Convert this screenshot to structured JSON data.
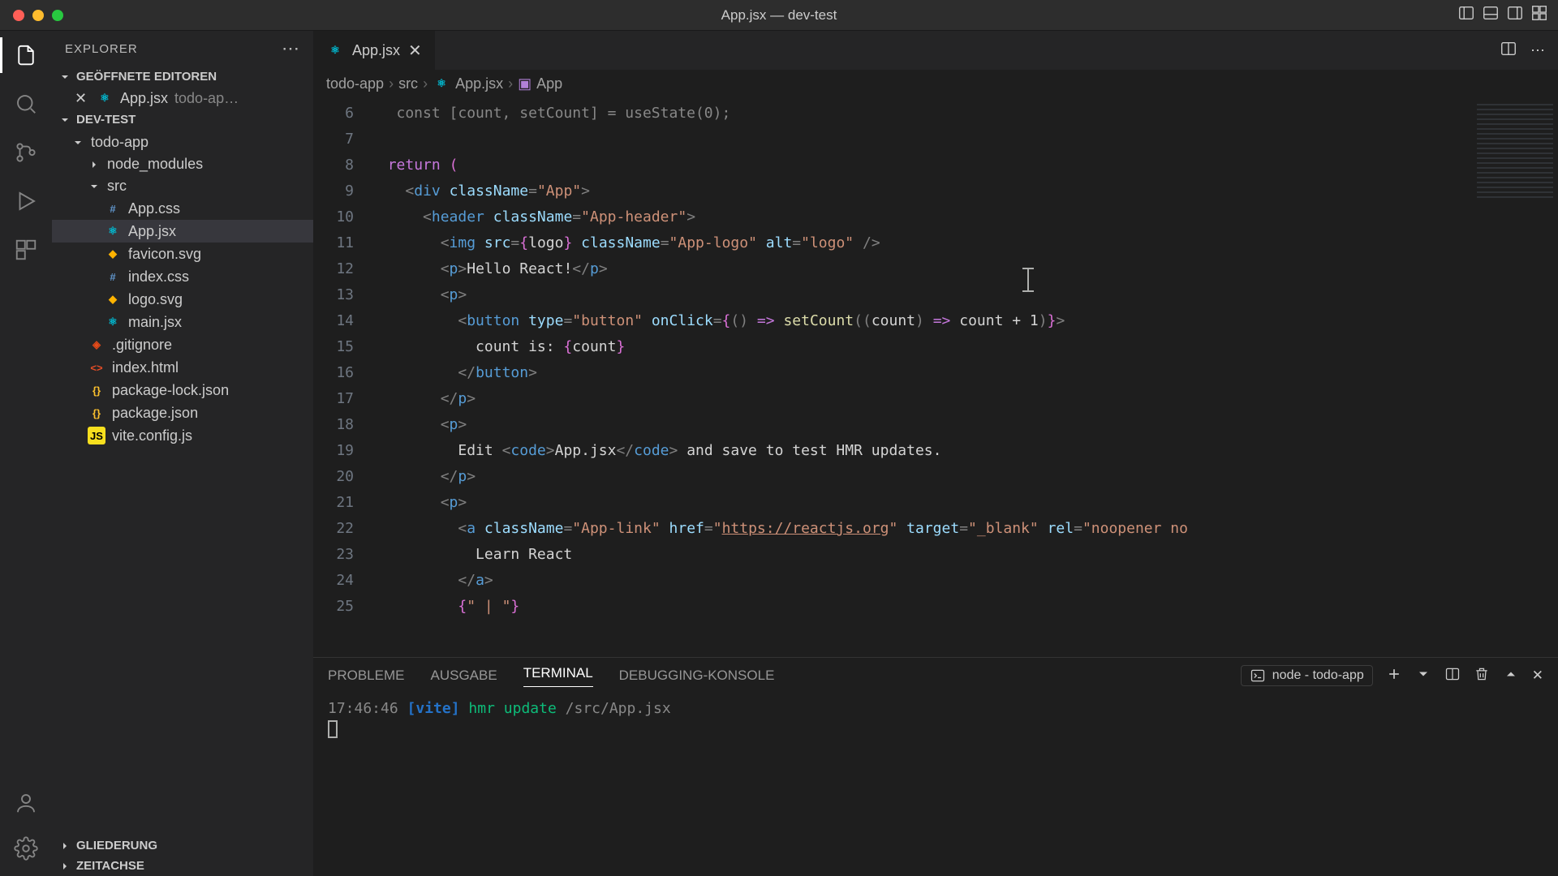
{
  "window": {
    "title": "App.jsx — dev-test"
  },
  "sidebar": {
    "title": "EXPLORER",
    "sections": {
      "openEditors": {
        "label": "GEÖFFNETE EDITOREN",
        "items": [
          {
            "name": "App.jsx",
            "path": "todo-ap…"
          }
        ]
      },
      "workspace": {
        "label": "DEV-TEST",
        "tree": {
          "todo_app": "todo-app",
          "node_modules": "node_modules",
          "src": "src",
          "files": {
            "app_css": "App.css",
            "app_jsx": "App.jsx",
            "favicon": "favicon.svg",
            "index_css": "index.css",
            "logo_svg": "logo.svg",
            "main_jsx": "main.jsx"
          },
          "gitignore": ".gitignore",
          "index_html": "index.html",
          "pkg_lock": "package-lock.json",
          "pkg": "package.json",
          "vite": "vite.config.js"
        }
      },
      "outline": "GLIEDERUNG",
      "timeline": "ZEITACHSE"
    }
  },
  "tabs": {
    "active": {
      "name": "App.jsx"
    }
  },
  "breadcrumb": {
    "seg1": "todo-app",
    "seg2": "src",
    "seg3": "App.jsx",
    "seg4": "App"
  },
  "editor": {
    "lineStart": 6,
    "lineNumbers": [
      "6",
      "7",
      "8",
      "9",
      "10",
      "11",
      "12",
      "13",
      "14",
      "15",
      "16",
      "17",
      "18",
      "19",
      "20",
      "21",
      "22",
      "23",
      "24",
      "25"
    ],
    "code": {
      "l8_return": "return",
      "l9_div": "div",
      "l9_className": "className",
      "l9_val": "\"App\"",
      "l10_header": "header",
      "l10_className": "className",
      "l10_val": "\"App-header\"",
      "l11_img": "img",
      "l11_src": "src",
      "l11_logo": "logo",
      "l11_className": "className",
      "l11_cls": "\"App-logo\"",
      "l11_alt": "alt",
      "l11_altv": "\"logo\"",
      "l12_p": "p",
      "l12_text": "Hello React!",
      "l14_button": "button",
      "l14_type": "type",
      "l14_typev": "\"button\"",
      "l14_onClick": "onClick",
      "l14_setCount": "setCount",
      "l14_count": "count",
      "l15_text": "count is: ",
      "l15_count": "count",
      "l19_edit": "Edit ",
      "l19_code": "code",
      "l19_file": "App.jsx",
      "l19_rest": " and save to test HMR updates.",
      "l22_a": "a",
      "l22_className": "className",
      "l22_cls": "\"App-link\"",
      "l22_href": "href",
      "l22_url": "https://reactjs.org",
      "l22_target": "target",
      "l22_tv": "\"_blank\"",
      "l22_rel": "rel",
      "l22_relv": "\"noopener no",
      "l23_text": "Learn React",
      "l25_text": "\" | \""
    }
  },
  "panel": {
    "tabs": {
      "problems": "PROBLEME",
      "output": "AUSGABE",
      "terminal": "TERMINAL",
      "debug": "DEBUGGING-KONSOLE"
    },
    "process": "node - todo-app",
    "terminal": {
      "time": "17:46:46",
      "tag": "[vite]",
      "msg": "hmr update",
      "path": "/src/App.jsx"
    }
  }
}
